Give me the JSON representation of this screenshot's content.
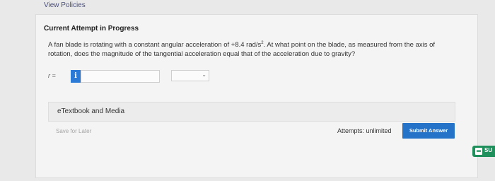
{
  "header": {
    "view_policies": "View Policies"
  },
  "attempt": {
    "title": "Current Attempt in Progress"
  },
  "question": {
    "text_before_sup": "A fan blade is rotating with a constant angular acceleration of +8.4 rad/s",
    "sup": "2",
    "text_after_sup": ". At what point on the blade, as measured from the axis of rotation, does the magnitude of the tangential acceleration equal that of the acceleration due to gravity?"
  },
  "answer": {
    "variable_label": "r =",
    "info_glyph": "i",
    "input_value": "",
    "unit_selected": ""
  },
  "etextbook": {
    "label": "eTextbook and Media"
  },
  "footer": {
    "save_label": "Save for Later",
    "attempts_text": "Attempts: unlimited",
    "submit_label": "Submit Answer"
  },
  "side_tab": {
    "label": "SU"
  },
  "colors": {
    "accent": "#2573c8",
    "info": "#2b7bd6",
    "side_tab": "#1f8f5c"
  }
}
